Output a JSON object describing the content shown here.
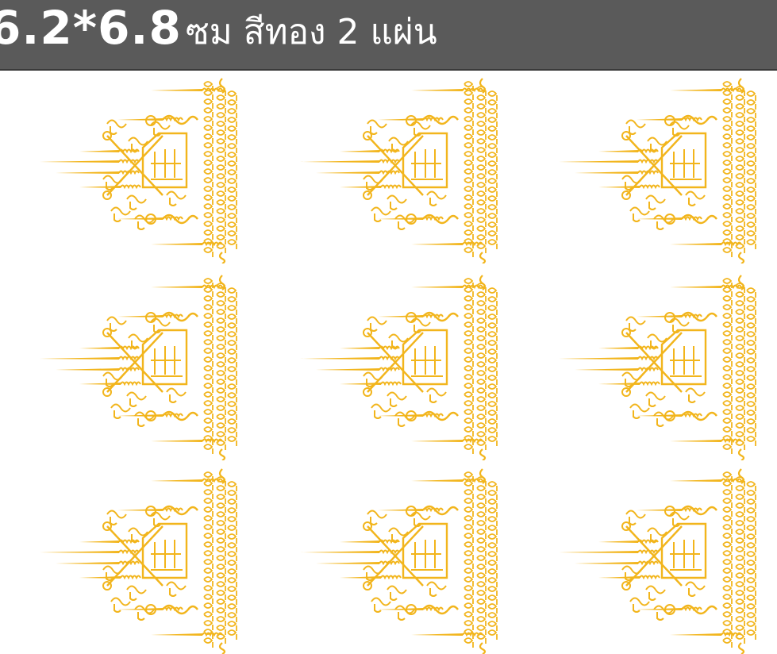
{
  "banner": {
    "size_text": "6.2*6.8",
    "desc_text": "ซม สีทอง 2 แผ่น"
  },
  "colors": {
    "banner_bg": "#5a5a5a",
    "gold": "#f2b51c"
  },
  "stickers": [
    {
      "icon": "yantra-gold-sticker-icon"
    },
    {
      "icon": "yantra-gold-sticker-icon"
    },
    {
      "icon": "yantra-gold-sticker-icon"
    },
    {
      "icon": "yantra-gold-sticker-icon"
    },
    {
      "icon": "yantra-gold-sticker-icon"
    },
    {
      "icon": "yantra-gold-sticker-icon"
    },
    {
      "icon": "yantra-gold-sticker-icon"
    },
    {
      "icon": "yantra-gold-sticker-icon"
    },
    {
      "icon": "yantra-gold-sticker-icon"
    }
  ]
}
